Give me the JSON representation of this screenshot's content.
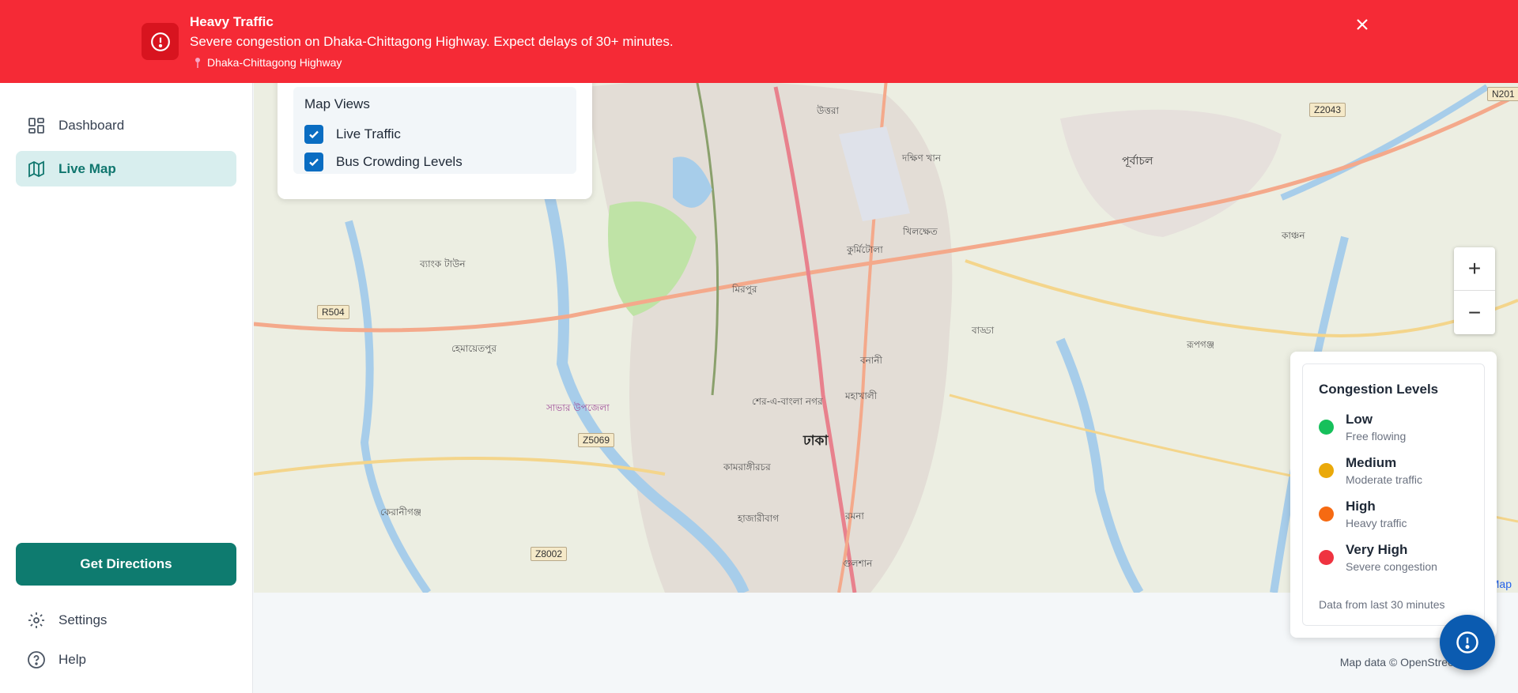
{
  "alert": {
    "title": "Heavy Traffic",
    "message": "Severe congestion on Dhaka-Chittagong Highway. Expect delays of 30+ minutes.",
    "location": "Dhaka-Chittagong Highway",
    "icon": "alert-circle-icon",
    "color": "#f52a36"
  },
  "sidebar": {
    "items": [
      {
        "label": "Dashboard",
        "icon": "dashboard-grid-icon"
      },
      {
        "label": "Live Map",
        "icon": "map-icon"
      }
    ],
    "cta": "Get Directions",
    "footer": [
      {
        "label": "Settings",
        "icon": "gear-icon"
      },
      {
        "label": "Help",
        "icon": "help-circle-icon"
      }
    ],
    "accent": "#0e7b6f"
  },
  "map_views": {
    "title": "Map Views",
    "options": [
      {
        "label": "Live Traffic",
        "checked": true
      },
      {
        "label": "Bus Crowding Levels",
        "checked": true
      }
    ]
  },
  "zoom": {
    "in": "+",
    "out": "−"
  },
  "legend": {
    "title": "Congestion Levels",
    "levels": [
      {
        "name": "Low",
        "desc": "Free flowing",
        "color": "#16c05b"
      },
      {
        "name": "Medium",
        "desc": "Moderate traffic",
        "color": "#eaa90a"
      },
      {
        "name": "High",
        "desc": "Heavy traffic",
        "color": "#f66a12"
      },
      {
        "name": "Very High",
        "desc": "Severe congestion",
        "color": "#ef3340"
      }
    ],
    "footer": "Data from last 30 minutes"
  },
  "map": {
    "attribution": "Map data © OpenStreetMap",
    "attribution_partial": "Map",
    "labels": {
      "dhaka": "ঢাকা",
      "uttara": "উত্তরা",
      "mirpur": "মিরপুর",
      "purbachal": "পূর্বাচল",
      "tejgaon": "শের-এ-বাংলা নগর",
      "gulshan": "গুলশান",
      "ramna": "রমনা",
      "savar": "সাভার উপজেলা",
      "rupganj": "রূপগঞ্জ",
      "kachpur": "কাঞ্চন",
      "kurmitola": "কুর্মিটোলা",
      "badda": "বাড্ডা",
      "kamrangirchar": "কামরাঙ্গীরচর",
      "hemayetpur": "হেমায়েতপুর",
      "hazaribagh": "হাজারীবাগ",
      "keraniganj": "কেরানীগঞ্জ",
      "bank_town": "ব্যাংক টাউন",
      "dakshinkhan": "দক্ষিণ খান",
      "banani": "বনানী",
      "mohakhali": "মহাখালী",
      "khilkhet": "খিলক্ষেত"
    },
    "shields": [
      "R504",
      "Z5069",
      "Z8002",
      "Z2043",
      "N201"
    ]
  },
  "fab_icon": "alert-circle-icon"
}
